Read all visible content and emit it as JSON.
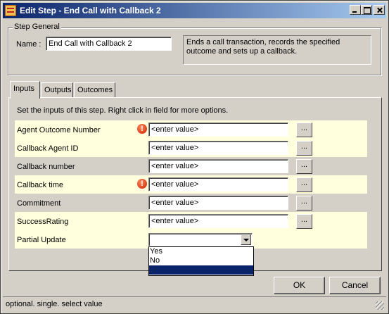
{
  "window": {
    "title": "Edit Step - End Call with Callback 2"
  },
  "step_general": {
    "legend": "Step General",
    "name_label": "Name :",
    "name_value": "End Call with Callback 2",
    "description": "Ends a call transaction, records the specified outcome and sets up a callback."
  },
  "tabs": [
    {
      "label": "Inputs",
      "active": true
    },
    {
      "label": "Outputs",
      "active": false
    },
    {
      "label": "Outcomes",
      "active": false
    }
  ],
  "inputs": {
    "hint": "Set the inputs of this step.  Right click in field for more options.",
    "rows": [
      {
        "label": "Agent Outcome Number",
        "value": "<enter value>",
        "warning": true
      },
      {
        "label": "Callback Agent ID",
        "value": "<enter value>",
        "warning": false
      },
      {
        "label": "Callback number",
        "value": "<enter value>",
        "warning": false
      },
      {
        "label": "Callback time",
        "value": "<enter value>",
        "warning": true
      },
      {
        "label": "Commitment",
        "value": "<enter value>",
        "warning": false
      },
      {
        "label": "SuccessRating",
        "value": "<enter value>",
        "warning": false
      }
    ],
    "ellipsis": "...",
    "warning_glyph": "!",
    "partial_update": {
      "label": "Partial Update",
      "value": "",
      "options": [
        "Yes",
        "No",
        ""
      ]
    }
  },
  "buttons": {
    "ok": "OK",
    "cancel": "Cancel"
  },
  "status": "optional. single. select value",
  "colors": {
    "title_start": "#0a246a",
    "title_end": "#a6caf0",
    "row_highlight": "#ffffde",
    "face": "#d4d0c8",
    "warning": "#c81e00"
  }
}
